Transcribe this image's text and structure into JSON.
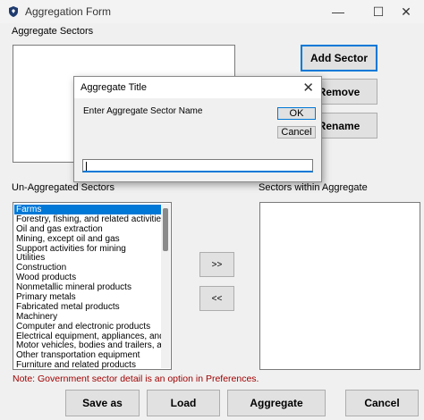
{
  "window": {
    "title": "Aggregation Form",
    "controls": {
      "minimize": "—",
      "maximize": "☐",
      "close": "✕"
    }
  },
  "labels": {
    "aggregate_sectors": "Aggregate Sectors",
    "unaggregated_sectors": "Un-Aggregated Sectors",
    "sectors_within_aggregate": "Sectors within Aggregate"
  },
  "buttons": {
    "add_sector": "Add Sector",
    "remove": "Remove",
    "rename": "Rename",
    "move_right": ">>",
    "move_left": "<<",
    "save_as": "Save as",
    "load": "Load",
    "aggregate": "Aggregate",
    "cancel": "Cancel"
  },
  "unaggregated_list": {
    "selected": "Farms",
    "items": [
      "Farms",
      "Forestry, fishing, and related activities",
      "Oil and gas extraction",
      "Mining, except oil and gas",
      "Support activities for mining",
      "Utilities",
      "Construction",
      "Wood products",
      "Nonmetallic mineral products",
      "Primary metals",
      "Fabricated metal products",
      "Machinery",
      "Computer and electronic products",
      "Electrical equipment, appliances, and",
      "Motor vehicles, bodies and trailers, ar",
      "Other transportation equipment",
      "Furniture and related products"
    ]
  },
  "note": "Note: Government sector detail is an option in Preferences.",
  "dialog": {
    "title": "Aggregate Title",
    "close": "✕",
    "prompt": "Enter Aggregate Sector Name",
    "ok": "OK",
    "cancel": "Cancel",
    "input_value": ""
  },
  "colors": {
    "accent": "#0078d7",
    "note": "#a00000",
    "selection": "#0078d7"
  }
}
